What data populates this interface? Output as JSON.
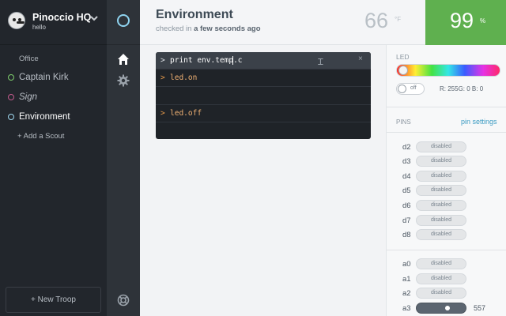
{
  "app": {
    "title": "Pinoccio HQ",
    "subtitle": "hello"
  },
  "sidebar": {
    "troop_name": "Office",
    "scouts": [
      {
        "label": "Captain Kirk",
        "status_color": "#7ecf6c"
      },
      {
        "label": "Sign",
        "status_color": "#c45a8e"
      },
      {
        "label": "Environment",
        "status_color": "#9fd9f0"
      }
    ],
    "add_scout": "+ Add a Scout",
    "new_troop": "+ New Troop"
  },
  "rail": {
    "icons": [
      "status-ring-icon",
      "home-icon",
      "gear-icon",
      "lifebuoy-icon"
    ]
  },
  "header": {
    "title": "Environment",
    "checked_prefix": "checked in ",
    "checked_time": "a few seconds ago",
    "temperature": "66",
    "temperature_unit": "°F",
    "humidity": "99",
    "humidity_unit": "%",
    "humidity_color": "#5fb04f"
  },
  "console": {
    "prompt": ">",
    "input_value": "print env.temp.c",
    "close": "×",
    "lines": [
      {
        "prompt": ">",
        "text": "led.on"
      },
      {
        "prompt": ">",
        "text": "led.off"
      }
    ]
  },
  "led": {
    "label": "LED",
    "toggle_label": "off",
    "rgb_readout": "R: 255G: 0    B: 0"
  },
  "pins": {
    "label": "PINS",
    "settings_link": "pin settings",
    "digital": [
      {
        "name": "d2",
        "state": "disabled"
      },
      {
        "name": "d3",
        "state": "disabled"
      },
      {
        "name": "d4",
        "state": "disabled"
      },
      {
        "name": "d5",
        "state": "disabled"
      },
      {
        "name": "d6",
        "state": "disabled"
      },
      {
        "name": "d7",
        "state": "disabled"
      },
      {
        "name": "d8",
        "state": "disabled"
      }
    ],
    "analog": [
      {
        "name": "a0",
        "state": "disabled"
      },
      {
        "name": "a1",
        "state": "disabled"
      },
      {
        "name": "a2",
        "state": "disabled"
      },
      {
        "name": "a3",
        "state": "",
        "value": "557"
      }
    ]
  }
}
